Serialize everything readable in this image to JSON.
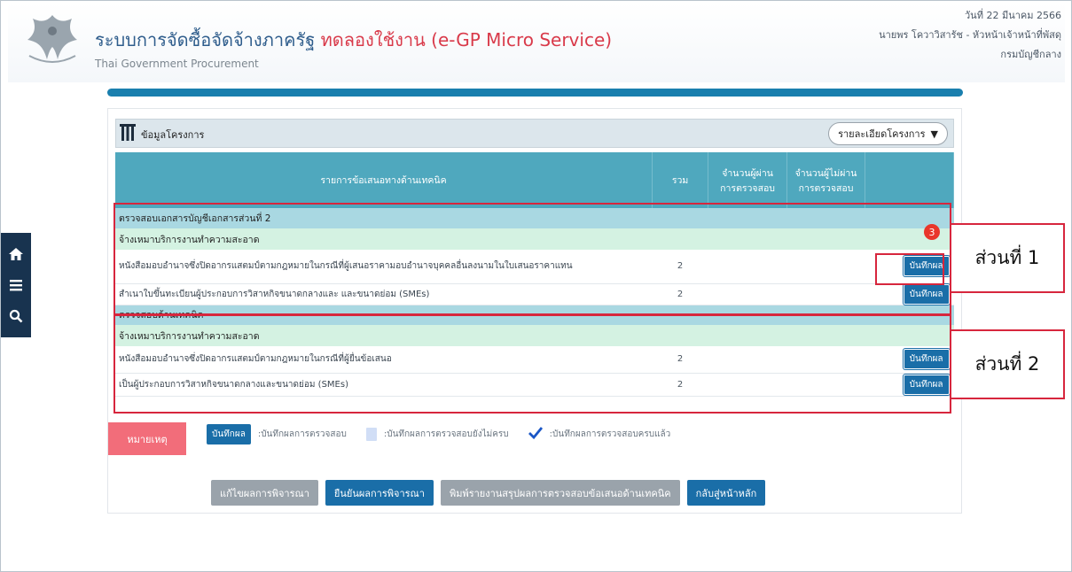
{
  "header": {
    "title": "ระบบการจัดซื้อจัดจ้างภาครัฐ",
    "trial_label": "ทดลองใช้งาน (e-GP Micro Service)",
    "subtitle": "Thai Government Procurement",
    "date": "วันที่ 22 มีนาคม 2566",
    "user": "นายพร โควาวิสารัช - หัวหน้าเจ้าหน้าที่พัสดุ",
    "department": "กรมบัญชีกลาง"
  },
  "side_nav": {
    "icons": [
      "home-icon",
      "menu-icon",
      "search-icon"
    ]
  },
  "panel": {
    "title": "ข้อมูลโครงการ",
    "detail_button": "รายละเอียดโครงการ"
  },
  "table": {
    "headers": [
      "รายการข้อเสนอทางด้านเทคนิค",
      "รวม",
      "จำนวนผู้ผ่าน\nการตรวจสอบ",
      "จำนวนผู้ไม่ผ่าน\nการตรวจสอบ",
      ""
    ],
    "section1": {
      "group": "ตรวจสอบเอกสารบัญชีเอกสารส่วนที่ 2",
      "sub": "จ้างเหมาบริการงานทำความสะอาด",
      "rows": [
        {
          "desc": "หนังสือมอบอำนาจซึ่งปิดอากรแสตมป์ตามกฎหมายในกรณีที่ผู้เสนอราคามอบอำนาจบุคคลอื่นลงนามในใบเสนอราคาแทน",
          "total": "2",
          "button": "บันทึกผล"
        },
        {
          "desc": "สำเนาใบขึ้นทะเบียนผู้ประกอบการวิสาหกิจขนาดกลางและ และขนาดย่อม (SMEs)",
          "total": "2",
          "button": "บันทึกผล"
        }
      ]
    },
    "section2": {
      "group": "ตรวจสอบด้านเทคนิค",
      "sub": "จ้างเหมาบริการงานทำความสะอาด",
      "rows": [
        {
          "desc": "หนังสือมอบอำนาจซึ่งปิดอากรแสตมป์ตามกฎหมายในกรณีที่ผู้ยื่นข้อเสนอ",
          "total": "2",
          "button": "บันทึกผล"
        },
        {
          "desc": "เป็นผู้ประกอบการวิสาหกิจขนาดกลางและขนาดย่อม (SMEs)",
          "total": "2",
          "button": "บันทึกผล"
        }
      ]
    }
  },
  "annotations": {
    "badge": "3",
    "callout1": "ส่วนที่ 1",
    "callout2": "ส่วนที่ 2",
    "color": "#d7263d"
  },
  "legend": {
    "note": "หมายเหตุ",
    "save_label": "บันทึกผล",
    "save_desc": ":บันทึกผลการตรวจสอบ",
    "incomplete_desc": ":บันทึกผลการตรวจสอบยังไม่ครบ",
    "complete_desc": ":บันทึกผลการตรวจสอบครบแล้ว"
  },
  "actions": {
    "edit": "แก้ไขผลการพิจารณา",
    "confirm": "ยืนยันผลการพิจารณา",
    "print": "พิมพ์รายงานสรุปผลการตรวจสอบข้อเสนอด้านเทคนิค",
    "back": "กลับสู่หน้าหลัก"
  },
  "colors": {
    "header_blue": "#2f5d8c",
    "trial_red": "#d93a4a",
    "table_head": "#4fa8be",
    "group_row": "#a9d8e2",
    "sub_row": "#d4f2e2",
    "primary_button": "#1a6ea8",
    "note_tab": "#f26d7a"
  }
}
